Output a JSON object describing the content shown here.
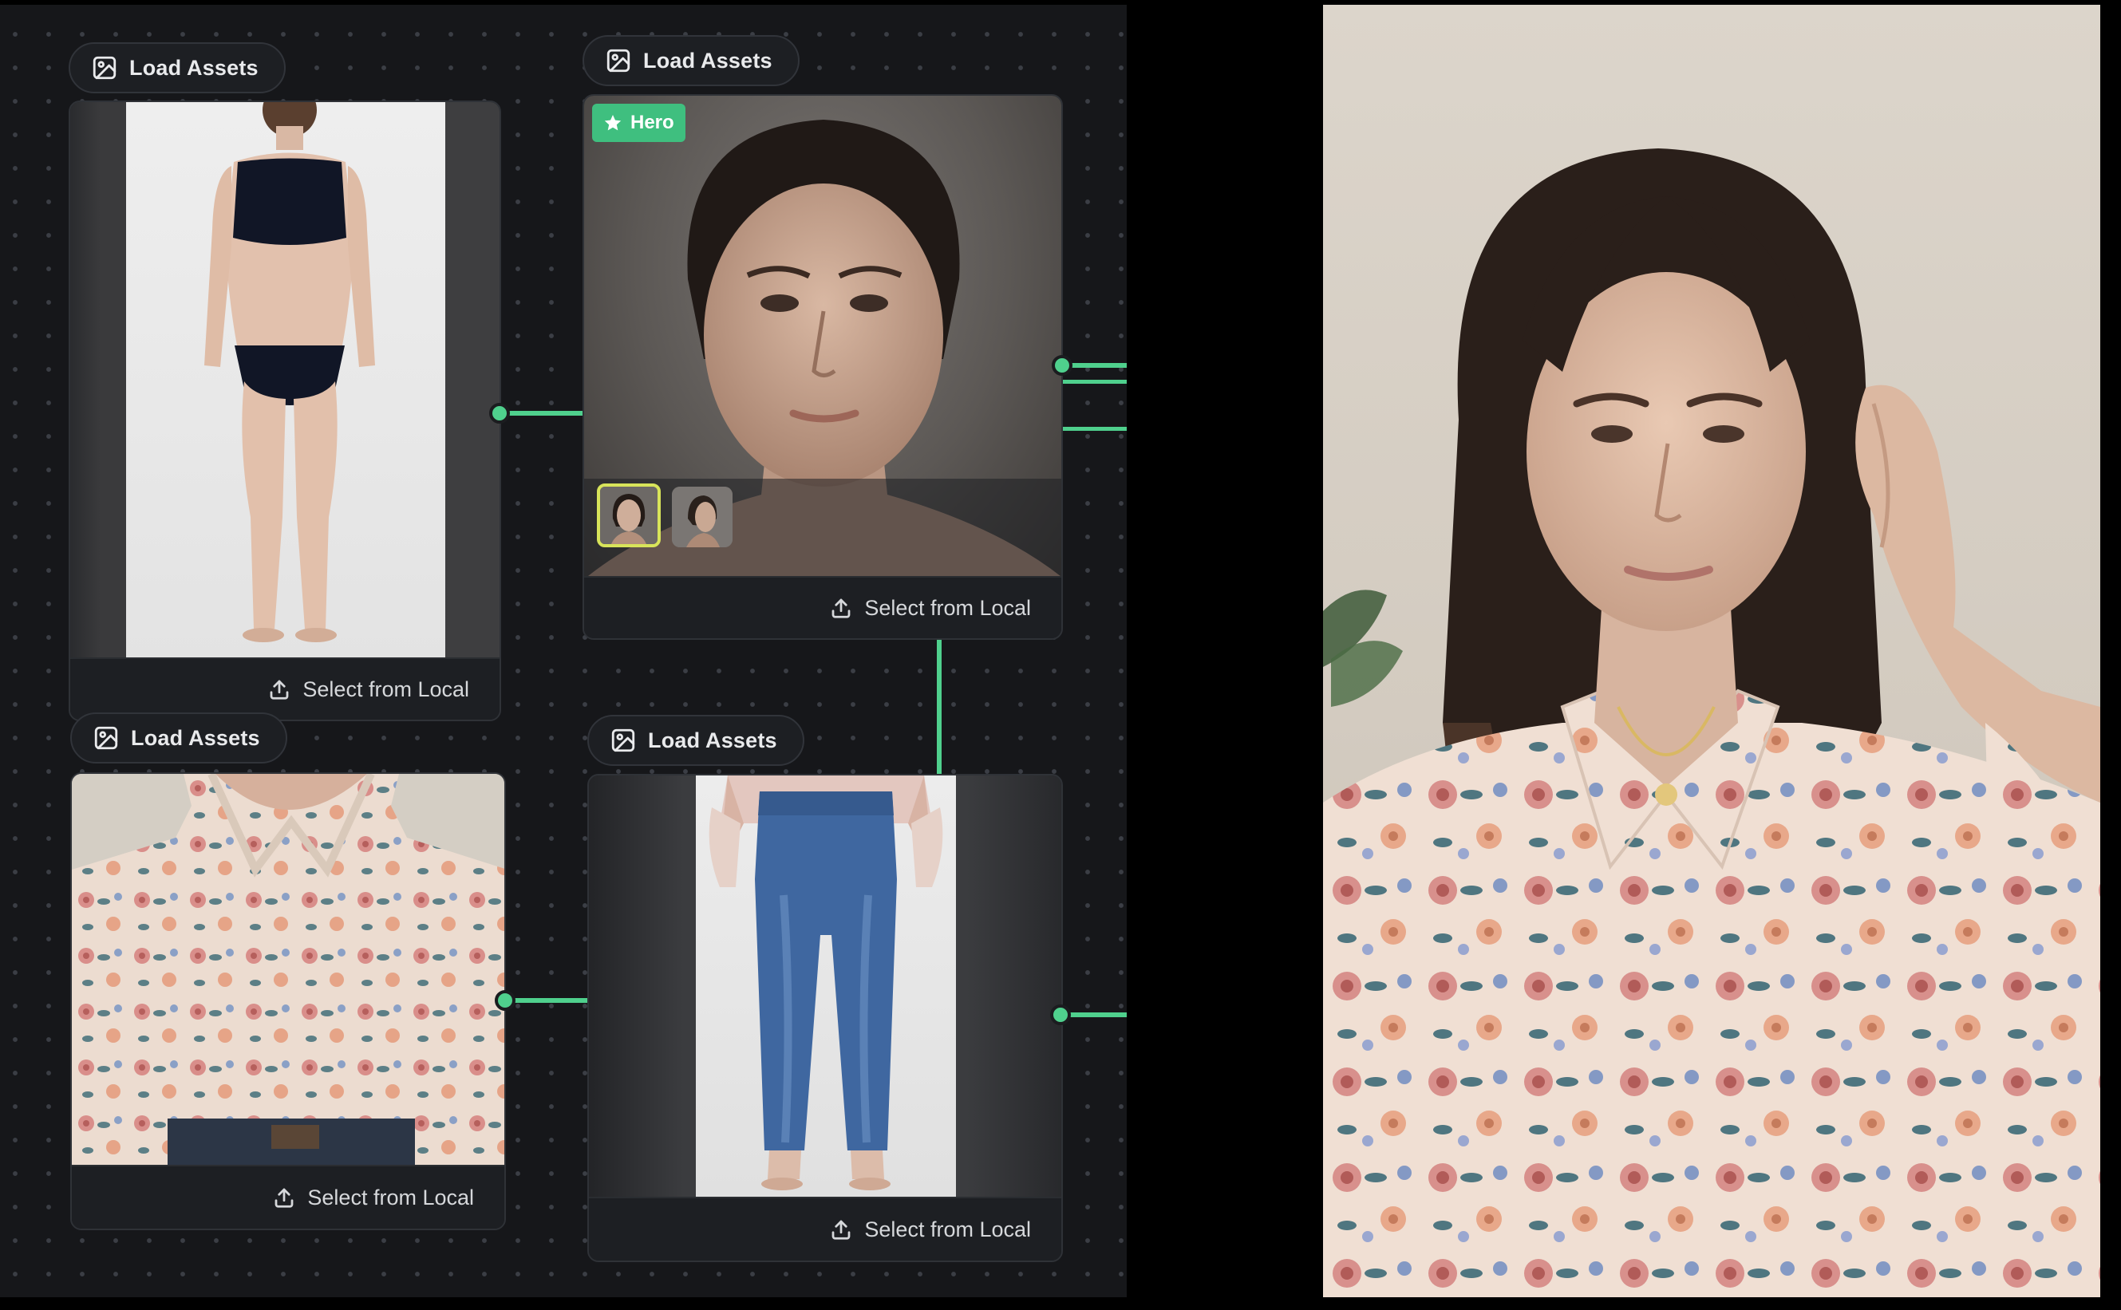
{
  "canvas": {
    "nodes": [
      {
        "id": "body",
        "header_label": "Load Assets",
        "footer_label": "Select from Local",
        "header_icon": "image-icon",
        "footer_icon": "upload-icon"
      },
      {
        "id": "face",
        "header_label": "Load Assets",
        "footer_label": "Select from Local",
        "header_icon": "image-icon",
        "footer_icon": "upload-icon",
        "badge": "Hero",
        "badge_icon": "star-icon",
        "thumbnails": 2,
        "selected_thumbnail": 1
      },
      {
        "id": "top",
        "header_label": "Load Assets",
        "footer_label": "Select from Local",
        "header_icon": "image-icon",
        "footer_icon": "upload-icon"
      },
      {
        "id": "bottom",
        "header_label": "Load Assets",
        "footer_label": "Select from Local",
        "header_icon": "image-icon",
        "footer_icon": "upload-icon"
      }
    ]
  },
  "colors": {
    "canvas_bg": "#16171a",
    "node_bg": "#1d1f23",
    "wire": "#4fd08d",
    "hero_badge": "#3fbf7f",
    "thumb_selected": "#d8e45a"
  }
}
